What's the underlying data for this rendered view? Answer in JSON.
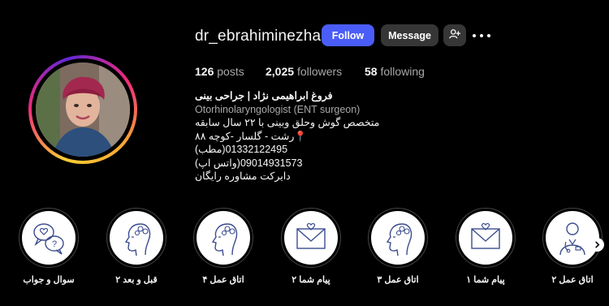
{
  "profile": {
    "username": "dr_ebrahiminezhad",
    "follow_label": "Follow",
    "message_label": "Message",
    "add_user_icon": "person-plus-icon",
    "more_icon": "more-horizontal-icon"
  },
  "stats": {
    "posts_count": "126",
    "posts_label": "posts",
    "followers_count": "2,025",
    "followers_label": "followers",
    "following_count": "58",
    "following_label": "following"
  },
  "bio": {
    "name": "فروغ ابراهیمی نژاد | جراحی بینی",
    "category": "Otorhinolaryngologist (ENT surgeon)",
    "lines": [
      "متخصص گوش وحلق وبینی با ۲۲ سال سابقه",
      "📍رشت - گلسار -کوچه ۸۸",
      "01332122495(مطب)",
      "09014931573(واتس اپ)",
      "دایرکت مشاوره رایگان"
    ]
  },
  "highlights": [
    {
      "label": "سوال و جواب",
      "icon": "chat-bubbles-icon"
    },
    {
      "label": "قبل و بعد ۲",
      "icon": "face-profile-icon"
    },
    {
      "label": "اتاق عمل ۴",
      "icon": "face-profile-icon"
    },
    {
      "label": "پیام شما ۲",
      "icon": "envelope-heart-icon"
    },
    {
      "label": "اتاق عمل ۳",
      "icon": "face-profile-icon"
    },
    {
      "label": "پیام شما ۱",
      "icon": "envelope-heart-icon"
    },
    {
      "label": "اتاق عمل ۲",
      "icon": "doctor-icon"
    }
  ],
  "colors": {
    "accent": "#4a5df9",
    "background": "#000000",
    "secondary_button": "#363636",
    "muted_text": "#a8a8a8",
    "icon_blue": "#3b4c8f"
  }
}
